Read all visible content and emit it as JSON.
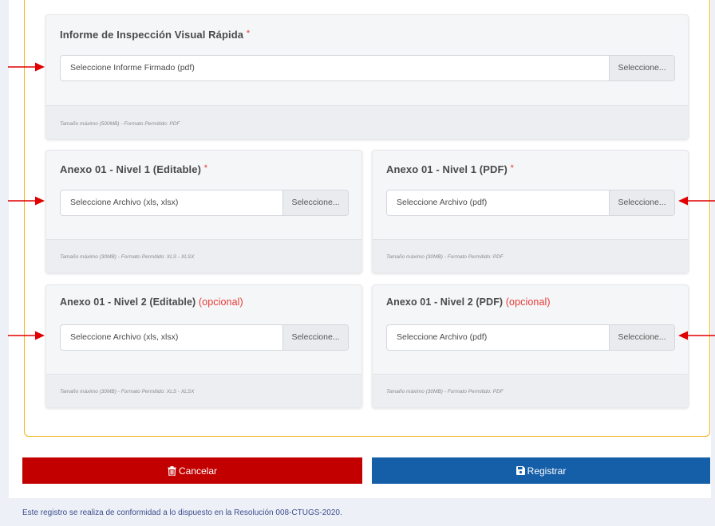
{
  "main_report": {
    "title": "Informe de Inspección Visual Rápida",
    "required_mark": "*",
    "placeholder": "Seleccione Informe Firmado (pdf)",
    "button": "Seleccione...",
    "note": "Tamaño máximo (500MB)  -  Formato Permitido: PDF"
  },
  "annex_cards": [
    {
      "title": "Anexo 01 - Nivel 1 (Editable)",
      "marker": "*",
      "placeholder": "Seleccione Archivo (xls, xlsx)",
      "button": "Seleccione...",
      "note": "Tamaño máximo (30MB)  -  Formato Permitido: XLS - XLSX"
    },
    {
      "title": "Anexo 01 - Nivel 1 (PDF)",
      "marker": "*",
      "placeholder": "Seleccione Archivo (pdf)",
      "button": "Seleccione...",
      "note": "Tamaño máximo (30MB)  -  Formato Permitido: PDF"
    },
    {
      "title": "Anexo 01 - Nivel 2 (Editable)",
      "marker": "(opcional)",
      "placeholder": "Seleccione Archivo (xls, xlsx)",
      "button": "Seleccione...",
      "note": "Tamaño máximo (30MB)  -  Formato Permitido: XLS - XLSX"
    },
    {
      "title": "Anexo 01 - Nivel 2 (PDF)",
      "marker": "(opcional)",
      "placeholder": "Seleccione Archivo (pdf)",
      "button": "Seleccione...",
      "note": "Tamaño máximo (30MB)  -  Formato Permitido: PDF"
    }
  ],
  "actions": {
    "cancel_label": "Cancelar",
    "cancel_icon": "trash-icon",
    "save_label": "Registrar",
    "save_icon": "floppy-disk-icon"
  },
  "footer": {
    "text": "Este registro se realiza de conformidad a lo dispuesto en la Resolución 008-CTUGS-2020."
  },
  "colors": {
    "frame_border": "#f2b51c",
    "required": "#e53935",
    "arrow": "#e00000",
    "cancel": "#c20000",
    "save": "#155ea8"
  }
}
